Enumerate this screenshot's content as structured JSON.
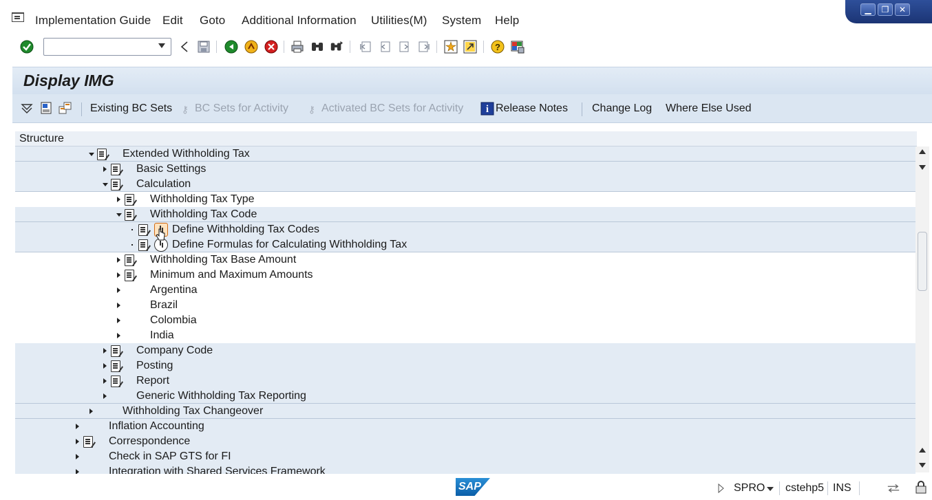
{
  "menu": {
    "items": [
      "Implementation Guide",
      "Edit",
      "Goto",
      "Additional Information",
      "Utilities(M)",
      "System",
      "Help"
    ]
  },
  "window_controls": {
    "minimize": "▁",
    "maximize": "❐",
    "close": "✕"
  },
  "toolbar": {
    "command_field_value": "",
    "icons": [
      "enter-icon",
      "back-arrow-icon",
      "save-icon",
      "back-icon",
      "exit-icon",
      "cancel-icon",
      "print-icon",
      "find-icon",
      "find-next-icon",
      "first-page-icon",
      "previous-page-icon",
      "next-page-icon",
      "last-page-icon",
      "create-session-icon",
      "shortcut-icon",
      "help-icon",
      "customize-layout-icon"
    ]
  },
  "page": {
    "title": "Display IMG"
  },
  "app_toolbar": {
    "existing_bc_sets": "Existing BC Sets",
    "bc_sets_for_activity": "BC Sets for Activity",
    "activated_bc_sets": "Activated BC Sets for Activity",
    "release_notes": "Release Notes",
    "change_log": "Change Log",
    "where_else_used": "Where Else Used"
  },
  "tree": {
    "header": "Structure",
    "rows": [
      {
        "label": "Extended Withholding Tax",
        "state": "open",
        "icon": "doc"
      },
      {
        "label": "Basic Settings",
        "state": "closed",
        "icon": "doc"
      },
      {
        "label": "Calculation",
        "state": "open",
        "icon": "doc"
      },
      {
        "label": "Withholding Tax Type",
        "state": "closed",
        "icon": "doc"
      },
      {
        "label": "Withholding Tax Code",
        "state": "open",
        "icon": "doc"
      },
      {
        "label": "Define Withholding Tax Codes",
        "state": "leaf",
        "icon": "doc+activity-hot"
      },
      {
        "label": "Define Formulas for Calculating Withholding Tax",
        "state": "leaf",
        "icon": "doc+activity"
      },
      {
        "label": "Withholding Tax Base Amount",
        "state": "closed",
        "icon": "doc"
      },
      {
        "label": "Minimum and Maximum Amounts",
        "state": "closed",
        "icon": "doc"
      },
      {
        "label": "Argentina",
        "state": "closed",
        "icon": "none"
      },
      {
        "label": "Brazil",
        "state": "closed",
        "icon": "none"
      },
      {
        "label": "Colombia",
        "state": "closed",
        "icon": "none"
      },
      {
        "label": "India",
        "state": "closed",
        "icon": "none"
      },
      {
        "label": "Company Code",
        "state": "closed",
        "icon": "doc"
      },
      {
        "label": "Posting",
        "state": "closed",
        "icon": "doc"
      },
      {
        "label": "Report",
        "state": "closed",
        "icon": "doc"
      },
      {
        "label": "Generic Withholding Tax Reporting",
        "state": "closed",
        "icon": "none"
      },
      {
        "label": "Withholding Tax Changeover",
        "state": "closed",
        "icon": "none"
      },
      {
        "label": "Inflation Accounting",
        "state": "closed",
        "icon": "none"
      },
      {
        "label": "Correspondence",
        "state": "closed",
        "icon": "doc"
      },
      {
        "label": "Check in SAP GTS for FI",
        "state": "closed",
        "icon": "none"
      },
      {
        "label": "Integration with Shared Services Framework",
        "state": "closed",
        "icon": "none"
      }
    ]
  },
  "status": {
    "logo": "SAP",
    "transaction": "SPRO",
    "server": "cstehp5",
    "mode": "INS"
  }
}
